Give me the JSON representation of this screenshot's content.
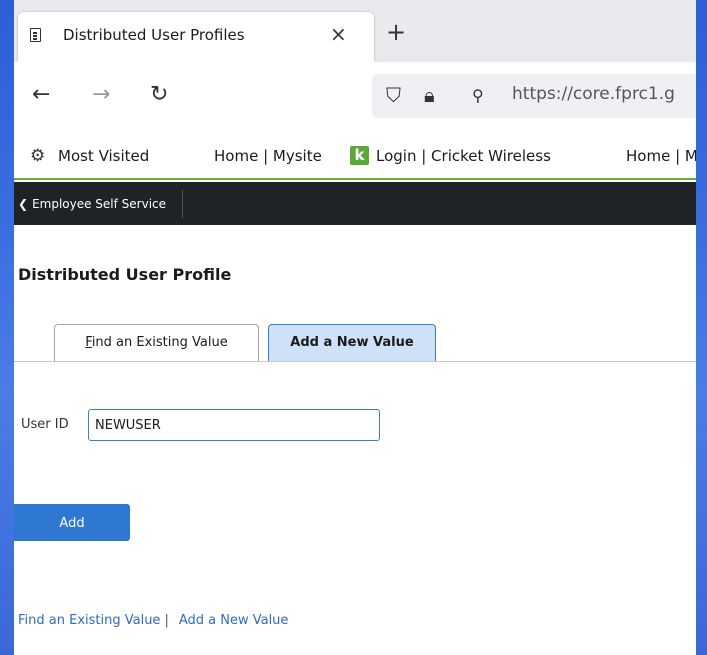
{
  "browser": {
    "tab_title": "Distributed User Profiles",
    "tab_close": "×",
    "new_tab": "+",
    "url": "https://core.fprc1.g"
  },
  "bookmarks": {
    "items": [
      "Most Visited",
      "Home | Mysite",
      "Login | Cricket Wireless",
      "Home | M"
    ]
  },
  "appbar": {
    "back_label": "Employee Self Service"
  },
  "page": {
    "title": "Distributed User Profile",
    "tabs": [
      {
        "label_first": "F",
        "label_rest": "ind an Existing Value",
        "active": false
      },
      {
        "label": "Add a New Value",
        "active": true
      }
    ],
    "form": {
      "userid_label": "User ID",
      "userid_value": "NEWUSER"
    },
    "add_button": "Add",
    "footer_links": [
      "Find an Existing Value",
      "Add a New Value"
    ],
    "footer_sep": "|"
  },
  "colors": {
    "accent": "#2e78d1",
    "active_tab_bg": "#cfe1f7",
    "appbar_bg": "#1f2328",
    "bookmark_underline": "#61b338"
  }
}
